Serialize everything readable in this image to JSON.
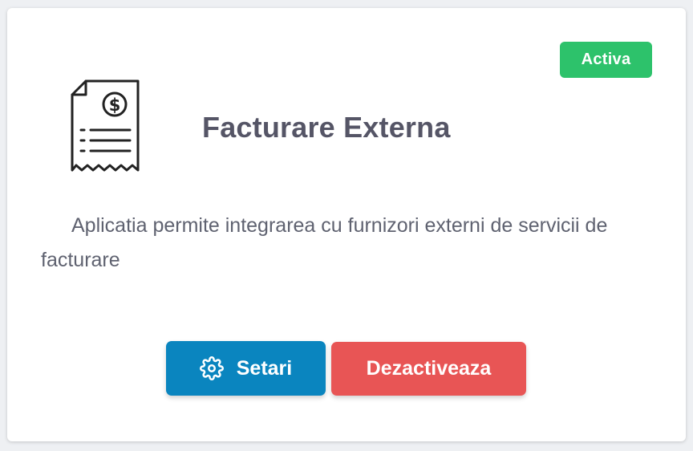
{
  "card": {
    "status_badge": "Activa",
    "title": "Facturare Externa",
    "description": "Aplicatia permite integrarea cu furnizori externi de servicii de facturare",
    "logo_icon": "invoice-dollar-icon",
    "buttons": {
      "settings_label": "Setari",
      "settings_icon": "gear-icon",
      "deactivate_label": "Dezactiveaza"
    }
  },
  "colors": {
    "badge": "#2dc26b",
    "settings_button": "#0a85bf",
    "deactivate_button": "#e85555",
    "title_text": "#555566"
  }
}
